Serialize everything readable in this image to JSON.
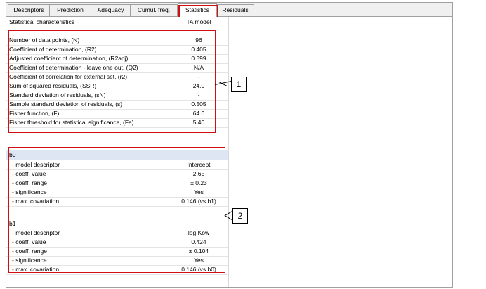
{
  "tabs": [
    {
      "label": "Descriptors",
      "active": false
    },
    {
      "label": "Prediction",
      "active": false
    },
    {
      "label": "Adequacy",
      "active": false
    },
    {
      "label": "Cumul. freq.",
      "active": false
    },
    {
      "label": "Statistics",
      "active": true
    },
    {
      "label": "Residuals",
      "active": false
    }
  ],
  "table": {
    "header": {
      "label": "Statistical characteristics",
      "model": "TA model"
    },
    "stats": [
      {
        "label": "Number of data points,  (N)",
        "value": "96"
      },
      {
        "label": "Coefficient of determination,  (R2)",
        "value": "0.405"
      },
      {
        "label": "Adjusted coefficient of determination,  (R2adj)",
        "value": "0.399"
      },
      {
        "label": "Coefficient of determination - leave one out,  (Q2)",
        "value": "N/A"
      },
      {
        "label": "Coefficient of correlation for external set,  (r2)",
        "value": "-"
      },
      {
        "label": "Sum of squared residuals,  (SSR)",
        "value": "24.0"
      },
      {
        "label": "Standard deviation of residuals,  (sN)",
        "value": "-"
      },
      {
        "label": "Sample standard deviation of residuals,  (s)",
        "value": "0.505"
      },
      {
        "label": "Fisher function,  (F)",
        "value": "64.0"
      },
      {
        "label": "Fisher threshold for statistical significance,  (Fa)",
        "value": "5.40"
      }
    ],
    "coefficients": [
      {
        "name": "b0",
        "rows": [
          {
            "label": "- model descriptor",
            "value": "Intercept"
          },
          {
            "label": "- coeff. value",
            "value": "2.65"
          },
          {
            "label": "- coeff. range",
            "value": "± 0.23"
          },
          {
            "label": "- significance",
            "value": "Yes"
          },
          {
            "label": "- max. covariation",
            "value": "0.146  (vs b1)"
          }
        ]
      },
      {
        "name": "b1",
        "rows": [
          {
            "label": "- model descriptor",
            "value": "log Kow"
          },
          {
            "label": "- coeff. value",
            "value": "0.424"
          },
          {
            "label": "- coeff. range",
            "value": "± 0.104"
          },
          {
            "label": "- significance",
            "value": "Yes"
          },
          {
            "label": "- max. covariation",
            "value": "0.146  (vs b0)"
          }
        ]
      }
    ]
  },
  "callouts": [
    {
      "label": "1"
    },
    {
      "label": "2"
    }
  ],
  "colors": {
    "highlight": "#d01010",
    "selected_row": "#dde6f2"
  }
}
